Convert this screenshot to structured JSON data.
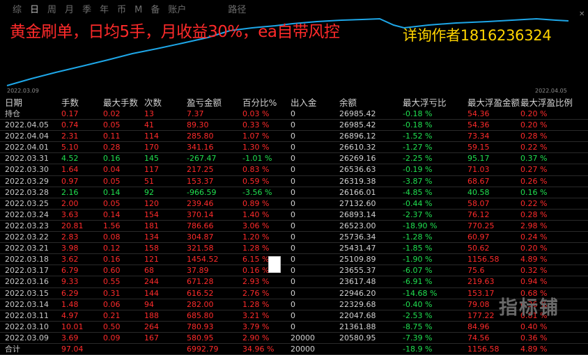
{
  "tabs": [
    {
      "label": "综"
    },
    {
      "label": "日"
    },
    {
      "label": "周"
    },
    {
      "label": "月"
    },
    {
      "label": "季"
    },
    {
      "label": "年"
    },
    {
      "label": "币"
    },
    {
      "label": "M"
    },
    {
      "label": "备"
    },
    {
      "label": "账户"
    },
    {
      "label": "路径"
    }
  ],
  "headline": "黄金刷单，日均5手，月收益30%，ea自带风控",
  "contact": "详询作者18162363​24",
  "chart": {
    "start_date": "2022.03.09",
    "end_date": "2022.04.05",
    "line_color": "#1ea7e8"
  },
  "columns": [
    "日期",
    "手数",
    "最大手数",
    "次数",
    "盈亏金额",
    "百分比%",
    "出入金",
    "余额",
    "最大浮亏比",
    "最大浮盈金额",
    "最大浮盈比例"
  ],
  "rows": [
    [
      "持仓",
      "0.17",
      "0.02",
      "13",
      "7.37",
      "0.03 %",
      "0",
      "26985.42",
      "-0.18 %",
      "54.36",
      "0.20 %"
    ],
    [
      "2022.04.05",
      "0.74",
      "0.05",
      "41",
      "89.30",
      "0.33 %",
      "0",
      "26985.42",
      "-0.18 %",
      "54.36",
      "0.20 %"
    ],
    [
      "2022.04.04",
      "2.31",
      "0.11",
      "114",
      "285.80",
      "1.07 %",
      "0",
      "26896.12",
      "-1.52 %",
      "73.34",
      "0.28 %"
    ],
    [
      "2022.04.01",
      "5.10",
      "0.28",
      "170",
      "341.16",
      "1.30 %",
      "0",
      "26610.32",
      "-1.27 %",
      "59.15",
      "0.22 %"
    ],
    [
      "2022.03.31",
      "4.52",
      "0.16",
      "145",
      "-267.47",
      "-1.01 %",
      "0",
      "26269.16",
      "-2.25 %",
      "95.17",
      "0.37 %"
    ],
    [
      "2022.03.30",
      "1.64",
      "0.04",
      "117",
      "217.25",
      "0.83 %",
      "0",
      "26536.63",
      "-0.19 %",
      "71.03",
      "0.27 %"
    ],
    [
      "2022.03.29",
      "0.97",
      "0.05",
      "51",
      "153.37",
      "0.59 %",
      "0",
      "26319.38",
      "-3.87 %",
      "68.67",
      "0.26 %"
    ],
    [
      "2022.03.28",
      "2.16",
      "0.14",
      "92",
      "-966.59",
      "-3.56 %",
      "0",
      "26166.01",
      "-4.85 %",
      "40.58",
      "0.16 %"
    ],
    [
      "2022.03.25",
      "2.00",
      "0.05",
      "120",
      "239.46",
      "0.89 %",
      "0",
      "27132.60",
      "-0.44 %",
      "58.07",
      "0.22 %"
    ],
    [
      "2022.03.24",
      "3.63",
      "0.14",
      "154",
      "370.14",
      "1.40 %",
      "0",
      "26893.14",
      "-2.37 %",
      "76.12",
      "0.28 %"
    ],
    [
      "2022.03.23",
      "20.81",
      "1.56",
      "181",
      "786.66",
      "3.06 %",
      "0",
      "26523.00",
      "-18.90 %",
      "770.25",
      "2.98 %"
    ],
    [
      "2022.03.22",
      "2.83",
      "0.08",
      "134",
      "304.87",
      "1.20 %",
      "0",
      "25736.34",
      "-1.28 %",
      "60.97",
      "0.24 %"
    ],
    [
      "2022.03.21",
      "3.98",
      "0.12",
      "158",
      "321.58",
      "1.28 %",
      "0",
      "25431.47",
      "-1.85 %",
      "50.62",
      "0.20 %"
    ],
    [
      "2022.03.18",
      "3.62",
      "0.16",
      "121",
      "1454.52",
      "6.15 %",
      "0",
      "25109.89",
      "-1.90 %",
      "1156.58",
      "4.89 %"
    ],
    [
      "2022.03.17",
      "6.79",
      "0.60",
      "68",
      "37.89",
      "0.16 %",
      "0",
      "23655.37",
      "-6.07 %",
      "75.6",
      "0.32 %"
    ],
    [
      "2022.03.16",
      "9.33",
      "0.55",
      "244",
      "671.28",
      "2.93 %",
      "0",
      "23617.48",
      "-6.91 %",
      "219.63",
      "0.94 %"
    ],
    [
      "2022.03.15",
      "6.29",
      "0.31",
      "144",
      "616.52",
      "2.76 %",
      "0",
      "22946.20",
      "-14.68 %",
      "153.17",
      "0.68 %"
    ],
    [
      "2022.03.14",
      "1.48",
      "0.06",
      "94",
      "282.00",
      "1.28 %",
      "0",
      "22329.68",
      "-0.40 %",
      "79.08",
      "0.36 %"
    ],
    [
      "2022.03.11",
      "4.97",
      "0.21",
      "188",
      "685.80",
      "3.21 %",
      "0",
      "22047.68",
      "-2.53 %",
      "177.22",
      "0.81 %"
    ],
    [
      "2022.03.10",
      "10.01",
      "0.50",
      "264",
      "780.93",
      "3.79 %",
      "0",
      "21361.88",
      "-8.75 %",
      "84.96",
      "0.40 %"
    ],
    [
      "2022.03.09",
      "3.69",
      "0.09",
      "167",
      "580.95",
      "2.90 %",
      "20000",
      "20580.95",
      "-7.39 %",
      "74.56",
      "0.36 %"
    ],
    [
      "合计",
      "97.04",
      "",
      "",
      "6992.79",
      "34.96 %",
      "20000",
      "",
      "-18.9 %",
      "1156.58",
      "4.89 %"
    ]
  ],
  "watermark": "指标铺",
  "colors": {
    "positive": "#ff2b2b",
    "negative": "#20e050",
    "headline": "#ff2a2a",
    "contact": "#ffd400",
    "background": "#000000"
  }
}
